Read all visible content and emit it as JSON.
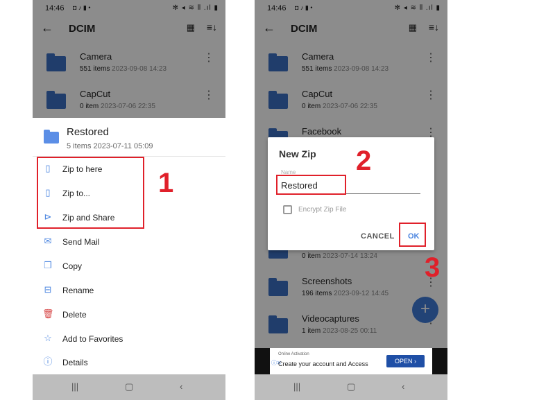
{
  "left": {
    "status": {
      "time": "14:46",
      "icons": "◘ ♪ ▮ •",
      "right": "✻ ◂ ≋ ⦀ .ıl ▮"
    },
    "appbar": {
      "back": "←",
      "title": "DCIM",
      "grid": "▦",
      "sort": "≡↓"
    },
    "folders": [
      {
        "name": "Camera",
        "count": "551 items",
        "date": "2023-09-08 14:23"
      },
      {
        "name": "CapCut",
        "count": "0 item",
        "date": "2023-07-06 22:35"
      }
    ],
    "sheet": {
      "title": "Restored",
      "meta": "5 items  2023-07-11 05:09",
      "items": [
        {
          "label": "Zip to here",
          "icon": "▯"
        },
        {
          "label": "Zip to...",
          "icon": "▯"
        },
        {
          "label": "Zip and Share",
          "icon": "⊳"
        },
        {
          "label": "Send Mail",
          "icon": "✉"
        },
        {
          "label": "Copy",
          "icon": "❐"
        },
        {
          "label": "Rename",
          "icon": "⊟"
        },
        {
          "label": "Delete",
          "icon": "🗑"
        },
        {
          "label": "Add to Favorites",
          "icon": "☆"
        },
        {
          "label": "Details",
          "icon": "ⓘ"
        }
      ]
    },
    "nav": {
      "recents": "|||",
      "home": "▢",
      "back": "‹"
    }
  },
  "right": {
    "status": {
      "time": "14:46",
      "icons": "◘ ♪ ▮ •",
      "right": "✻ ◂ ≋ ⦀ .ıl ▮"
    },
    "appbar": {
      "back": "←",
      "title": "DCIM",
      "grid": "▦",
      "sort": "≡↓"
    },
    "folders": [
      {
        "name": "Camera",
        "count": "551 items",
        "date": "2023-09-08 14:23"
      },
      {
        "name": "CapCut",
        "count": "0 item",
        "date": "2023-07-06 22:35"
      },
      {
        "name": "Facebook",
        "count": "",
        "date": ""
      },
      {
        "name": "",
        "count": "0 item",
        "date": "2023-07-14 13:24"
      },
      {
        "name": "Screenshots",
        "count": "196 items",
        "date": "2023-09-12 14:45"
      },
      {
        "name": "Videocaptures",
        "count": "1 item",
        "date": "2023-08-25 00:11"
      }
    ],
    "dialog": {
      "title": "New Zip",
      "hint": "Name",
      "value": "Restored",
      "encrypt_label": "Encrypt Zip File",
      "cancel": "CANCEL",
      "ok": "OK"
    },
    "fab": "+",
    "ad": {
      "small": "Online Activation",
      "main": "Create your account and Access",
      "button": "OPEN ›",
      "info": "ⓘ✕"
    },
    "nav": {
      "recents": "|||",
      "home": "▢",
      "back": "‹"
    }
  },
  "steps": [
    "1",
    "2",
    "3"
  ]
}
